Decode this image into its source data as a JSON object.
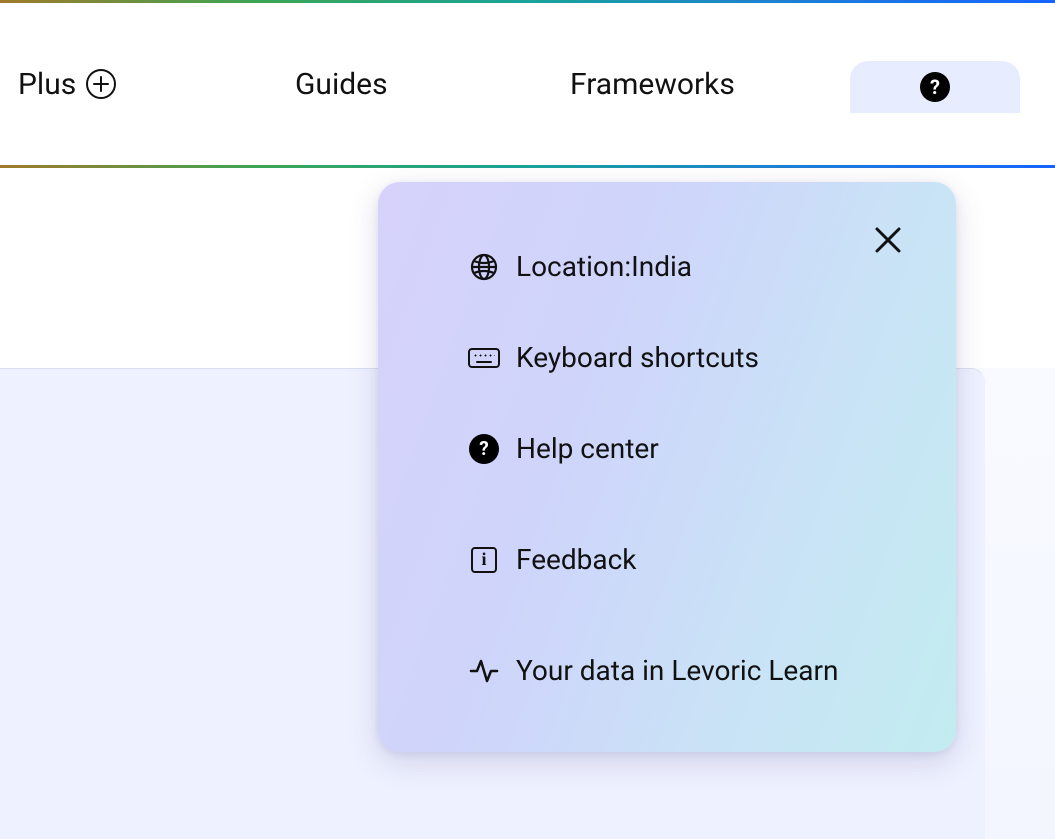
{
  "header": {
    "nav": {
      "plus_label": "Plus",
      "guides_label": "Guides",
      "frameworks_label": "Frameworks"
    }
  },
  "help_menu": {
    "location_prefix": "Location:",
    "location_value": "India",
    "keyboard_shortcuts_label": "Keyboard shortcuts",
    "help_center_label": "Help center",
    "feedback_label": "Feedback",
    "your_data_label": "Your data in Levoric Learn"
  }
}
